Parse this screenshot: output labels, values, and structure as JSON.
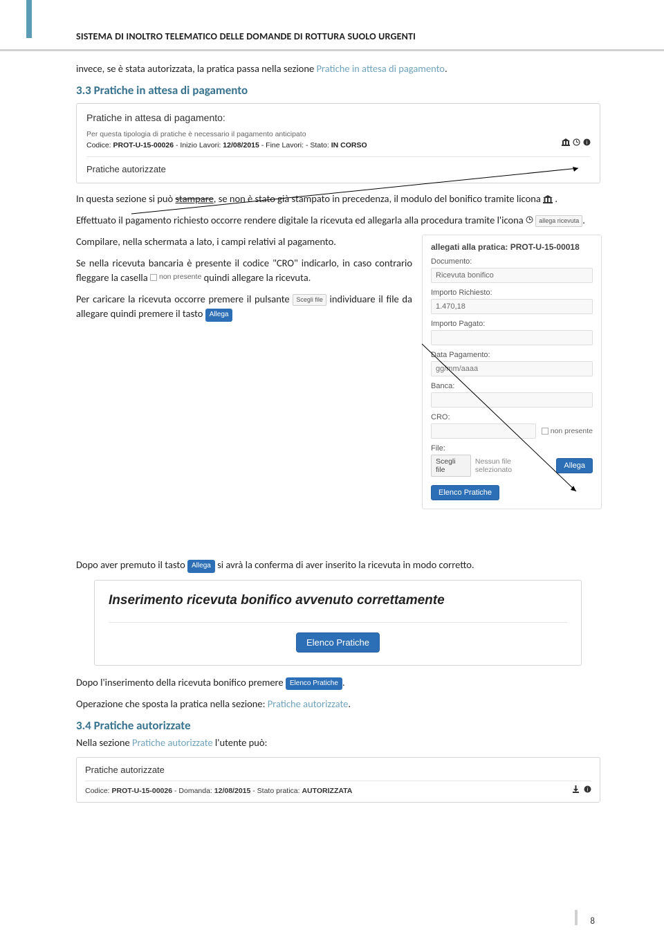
{
  "header": {
    "title": "SISTEMA DI INOLTRO TELEMATICO DELLE DOMANDE DI ROTTURA SUOLO URGENTI"
  },
  "intro": {
    "text_before": "invece, se è stata autorizzata, la pratica passa nella sezione ",
    "link": "Pratiche in attesa di pagamento",
    "dot": "."
  },
  "section33": {
    "heading": "3.3 Pratiche in attesa di pagamento"
  },
  "panel1": {
    "title": "Pratiche in attesa di pagamento:",
    "sub": "Per questa tipologia di pratiche è necessario il pagamento anticipato",
    "code_label": "Codice: ",
    "code": "PROT-U-15-00026",
    "mid": " - Inizio Lavori: ",
    "date1": "12/08/2015",
    "mid2": " - Fine Lavori: - Stato: ",
    "stato": "IN CORSO",
    "section2": "Pratiche autorizzate"
  },
  "para_stamp": {
    "p1a": "In questa sezione si può ",
    "p1b": "stampare",
    "p1c": ", se non è stato già stampato in precedenza, il modulo del bonifico tramite licona   ",
    "dot1": ".",
    "p2a": "Effettuato il pagamento richiesto occorre rendere digitale la ricevuta ed allegarla alla procedura tramite l'icona ",
    "attach_label": "allega ricevuta",
    "dot2": "."
  },
  "compile": {
    "p1": "Compilare, nella schermata a lato, i campi relativi al pagamento.",
    "p2a": "Se nella ricevuta bancaria è presente il codice \"CRO\" indicarlo, in caso contrario fleggare la casella ",
    "p2_flag": "non presente",
    "p2b": " quindi allegare la ricevuta.",
    "p3a": "Per caricare la ricevuta occorre premere il pulsante ",
    "p3_btn": "Scegli file",
    "p3b": " individuare il file da allegare quindi premere il tasto ",
    "p3_btn2": "Allega"
  },
  "form": {
    "heading_prefix": "allegati alla pratica: ",
    "heading_code": "PROT-U-15-00018",
    "doc_label": "Documento:",
    "doc_value": "Ricevuta bonifico",
    "imp_req_label": "Importo Richiesto:",
    "imp_req_value": "1.470,18",
    "imp_pag_label": "Importo Pagato:",
    "imp_pag_value": "",
    "data_label": "Data Pagamento:",
    "data_value": "gg/mm/aaaa",
    "banca_label": "Banca:",
    "cro_label": "CRO:",
    "non_presente": "non presente",
    "file_label": "File:",
    "scegli_file": "Scegli file",
    "nessun_file": "Nessun file selezionato",
    "allega": "Allega",
    "elenco": "Elenco Pratiche"
  },
  "after": {
    "p1a": "Dopo aver premuto il tasto ",
    "p1_btn": "Allega",
    "p1b": " si avrà la conferma di aver inserito la ricevuta in modo corretto."
  },
  "confirm": {
    "title": "Inserimento ricevuta bonifico avvenuto correttamente",
    "btn": "Elenco Pratiche"
  },
  "after2": {
    "p1a": "Dopo l'inserimento della ricevuta bonifico premere ",
    "p1_btn": "Elenco Pratiche",
    "dot": ".",
    "p2a": "Operazione che sposta la pratica nella sezione: ",
    "p2_link": "Pratiche autorizzate",
    "dot2": "."
  },
  "section34": {
    "heading": "3.4 Pratiche autorizzate",
    "sub_a": "Nella sezione ",
    "sub_link": "Pratiche autorizzate",
    "sub_b": " l'utente può:"
  },
  "auth_panel": {
    "title": "Pratiche autorizzate",
    "code_label": "Codice: ",
    "code": "PROT-U-15-00026",
    "mid": " - Domanda: ",
    "date": "12/08/2015",
    "mid2": " - Stato pratica: ",
    "stato": "AUTORIZZATA"
  },
  "page_number": "8"
}
